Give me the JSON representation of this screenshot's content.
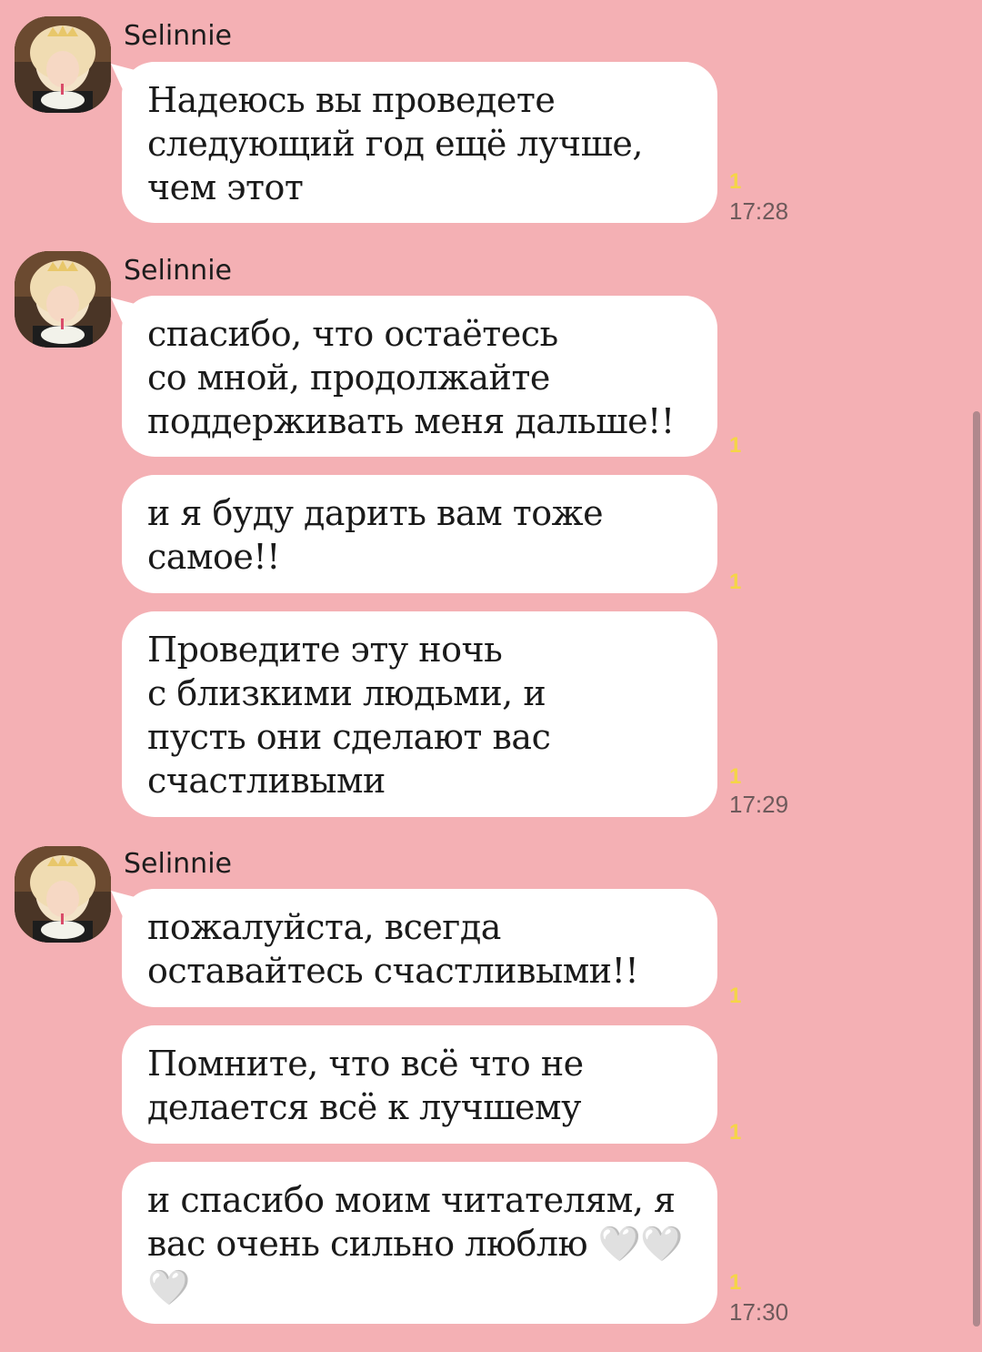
{
  "chat": {
    "groups": [
      {
        "sender": "Selinnie",
        "messages": [
          {
            "text": "Надеюсь вы проведете\nследующий год ещё лучше,\nчем этот",
            "read": "1",
            "time": "17:28"
          }
        ]
      },
      {
        "sender": "Selinnie",
        "messages": [
          {
            "text": "спасибо, что остаётесь\nсо мной, продолжайте\nподдерживать меня дальше!!",
            "read": "1",
            "time": ""
          },
          {
            "text": "и я буду дарить вам тоже\nсамое!!",
            "read": "1",
            "time": ""
          },
          {
            "text": "Проведите эту ночь\nс близкими людьми, и\nпусть они сделают вас\nсчастливыми",
            "read": "1",
            "time": "17:29"
          }
        ]
      },
      {
        "sender": "Selinnie",
        "messages": [
          {
            "text": "пожалуйста, всегда\nоставайтесь счастливыми!!",
            "read": "1",
            "time": ""
          },
          {
            "text": "Помните, что всё что не\nделается всё к лучшему",
            "read": "1",
            "time": ""
          },
          {
            "text": "и спасибо моим читателям, я\nвас очень сильно люблю 🤍🤍\n🤍",
            "read": "1",
            "time": "17:30"
          }
        ]
      }
    ]
  },
  "icons": {
    "avatar": "profile-photo-girl-with-cake"
  },
  "colors": {
    "background": "#f4b0b4",
    "bubble": "#ffffff",
    "read_count": "#f5d547",
    "timestamp": "#6e5a5b"
  }
}
